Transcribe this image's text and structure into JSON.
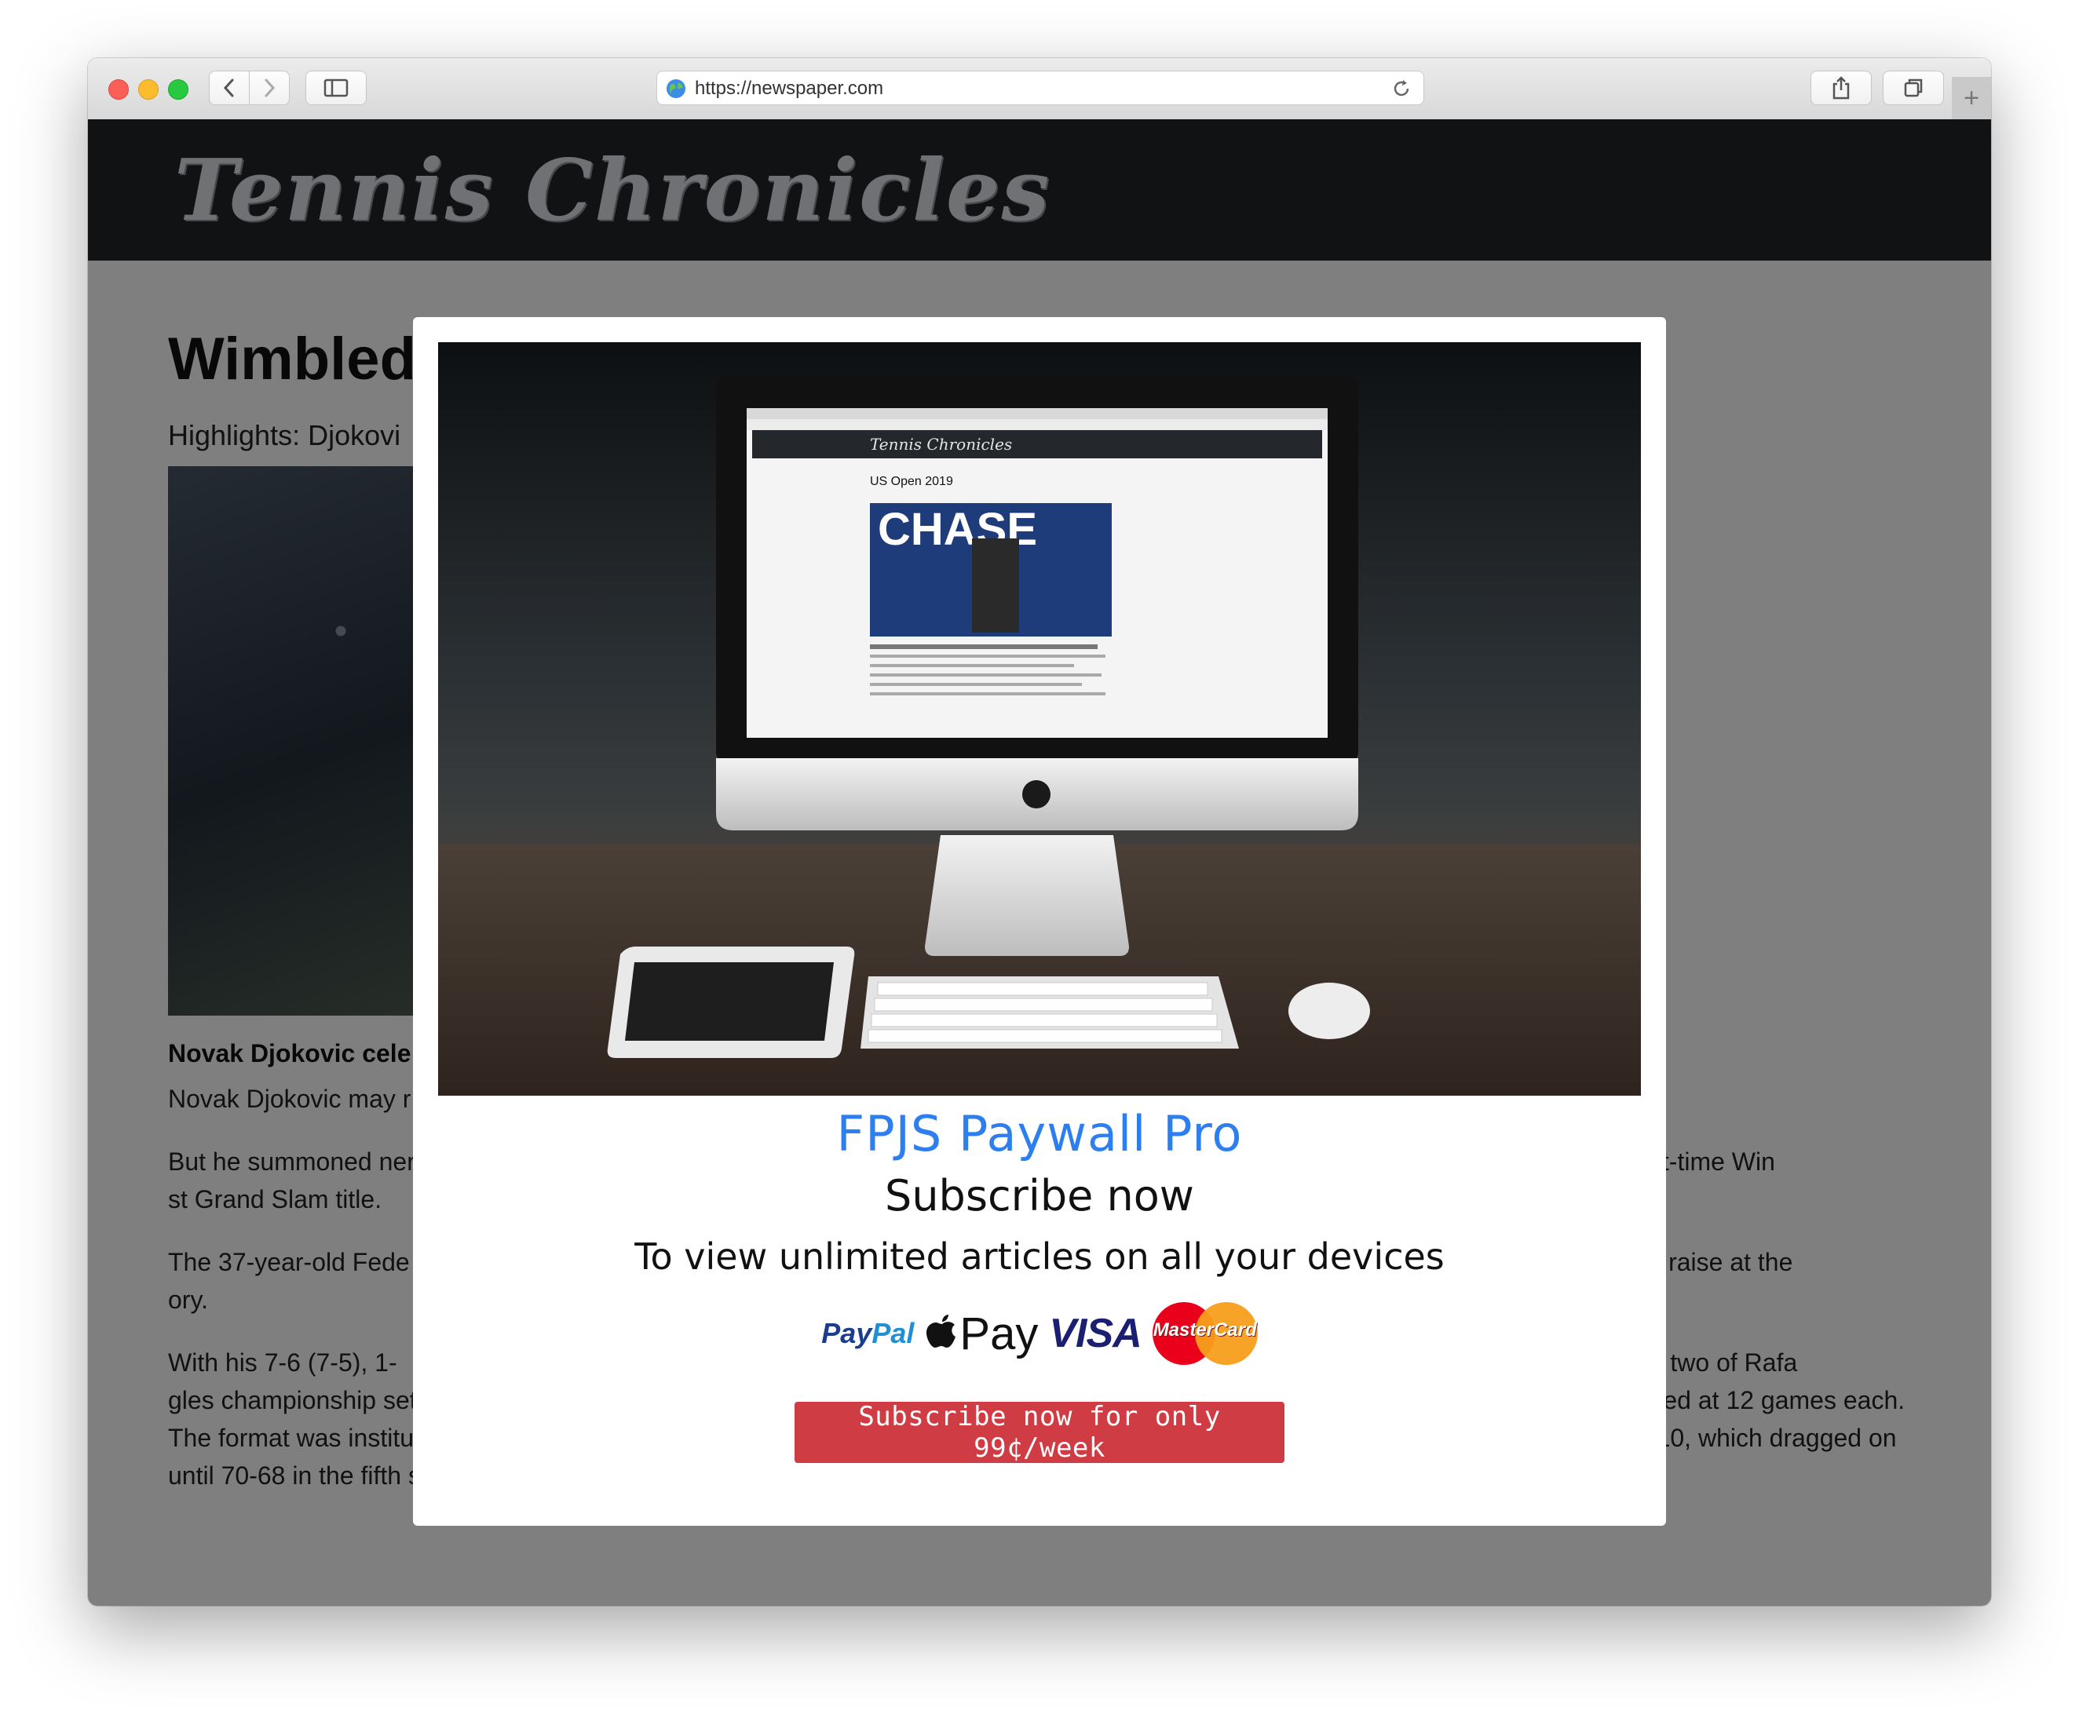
{
  "browser": {
    "url": "https://newspaper.com",
    "plus_label": "+"
  },
  "site": {
    "masthead_title": "Tennis Chronicles"
  },
  "article": {
    "title": "Wimbled",
    "subtitle": "Highlights: Djokovi",
    "caption": "Novak Djokovic cele",
    "paragraphs": [
      "Novak Djokovic may r",
      "But he summoned ner                                                                                                                                        ints required to defeat eight-time Win                                                                                                                                        st Grand Slam title.",
      "The 37-year-old Fede                                                                                                                                        t it was Djokovic’s trophy to raise at the                                                                                                                                        ory.",
      "With his 7-6 (7-5), 1-                                                                                                                                        tle of his career to pull within two of Rafa                                                                                                                                        gles championship settled under the tournament’s new tiebreak format, which was instituted this year and kicks in if the fifth set is knotted at 12 games each. The format was instituted to prevent soul-sapping marathons such as the three-day affair between John Isner and Nicolas Mahut in 2010, which dragged on until 70-68 in the fifth set, and last year’s semifinal between Isner and Kevin Anderson, which lasted to 26-24."
    ]
  },
  "paywall": {
    "brand": "FPJS Paywall Pro",
    "heading": "Subscribe now",
    "subheading": "To view unlimited articles on all your devices",
    "payment_methods": {
      "paypal_pay": "Pay",
      "paypal_pal": "Pal",
      "apple_pay": "Pay",
      "visa": "VISA",
      "mastercard": "MasterCard"
    },
    "cta_label": "Subscribe now for only 99¢/week",
    "hero_screen": {
      "masthead": "Tennis Chronicles",
      "headline": "US Open 2019",
      "sponsor": "CHASE"
    },
    "accent_color": "#2d7ff0",
    "cta_color": "#cf3c44"
  }
}
